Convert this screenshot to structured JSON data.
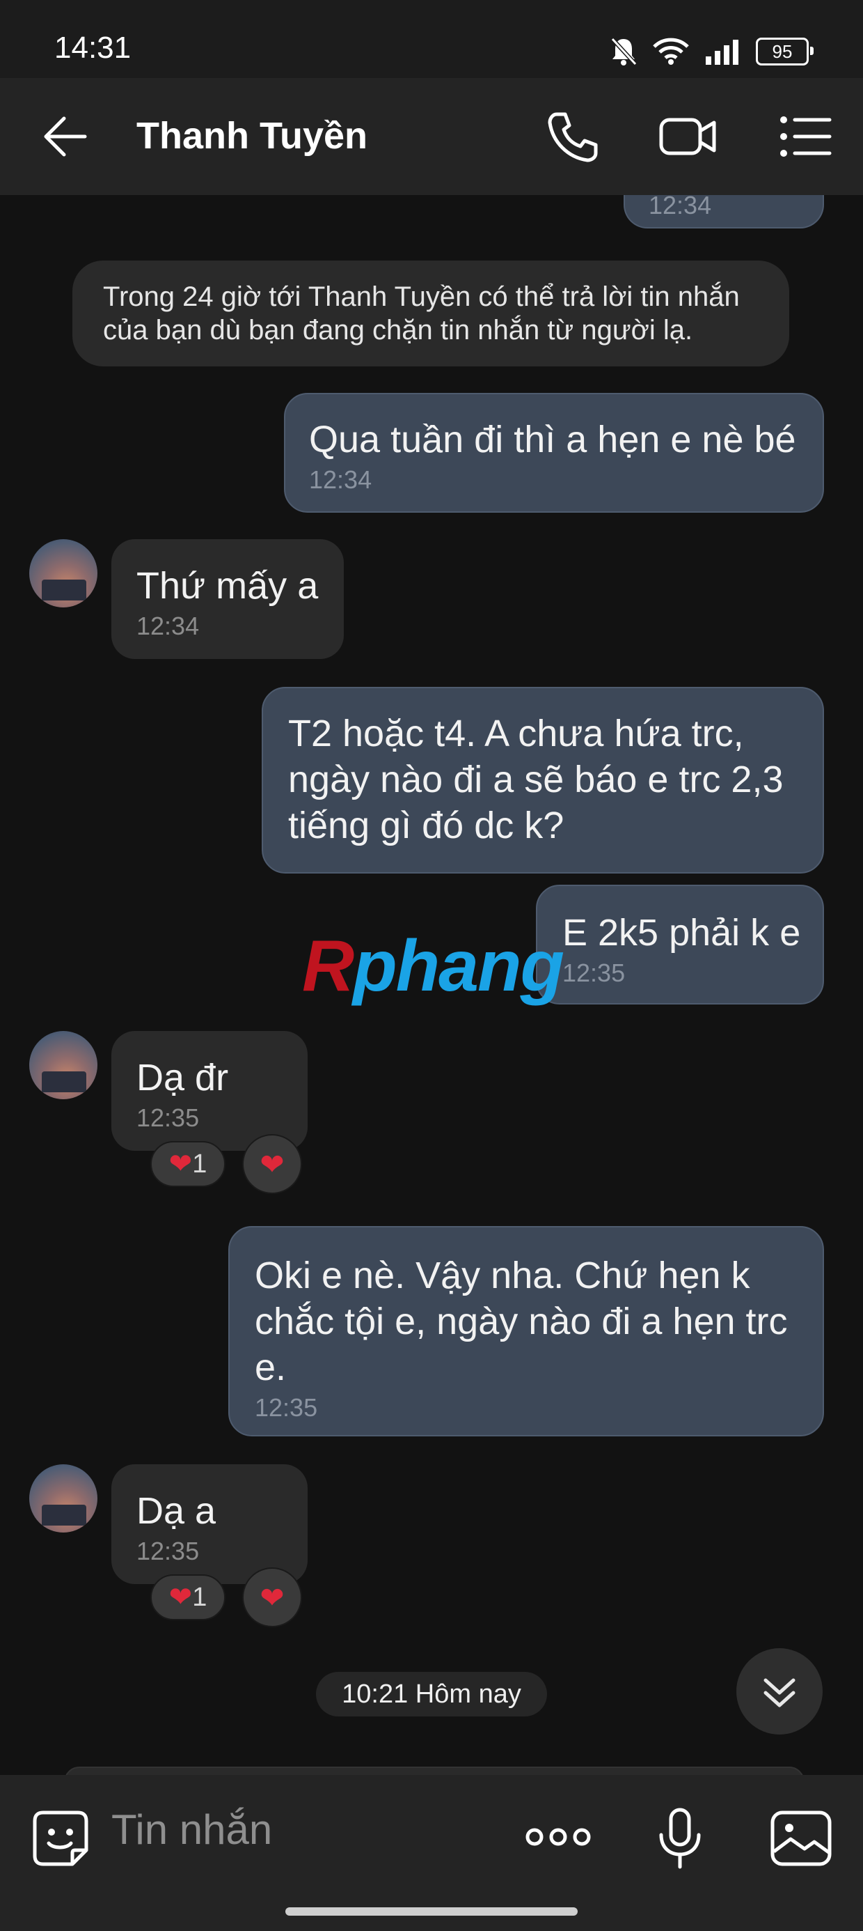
{
  "status_bar": {
    "time": "14:31",
    "battery": "95"
  },
  "header": {
    "contact_name": "Thanh Tuyền"
  },
  "notice_text": "Trong 24 giờ tới Thanh Tuyền có thể trả lời tin nhắn của bạn dù bạn đang chặn tin nhắn từ người lạ.",
  "messages": [
    {
      "direction": "out",
      "time": "12:34"
    },
    {
      "direction": "out",
      "text": "Qua tuần đi thì a hẹn e nè bé",
      "time": "12:34"
    },
    {
      "direction": "in",
      "text": "Thứ mấy a",
      "time": "12:34"
    },
    {
      "direction": "out",
      "text": "T2 hoặc t4. A chưa hứa trc, ngày nào đi a sẽ báo e trc 2,3 tiếng gì đó dc k?"
    },
    {
      "direction": "out",
      "text": "E 2k5 phải k e",
      "time": "12:35"
    },
    {
      "direction": "in",
      "text": "Dạ đr",
      "time": "12:35",
      "reaction_count": "1"
    },
    {
      "direction": "out",
      "text": "Oki e nè. Vậy nha. Chứ hẹn k chắc tội e, ngày nào đi a hẹn trc e.",
      "time": "12:35"
    },
    {
      "direction": "in",
      "text": "Dạ a",
      "time": "12:35",
      "reaction_count": "1"
    }
  ],
  "day_separator": "10:21 Hôm nay",
  "watermark": {
    "first": "R",
    "rest": "phang"
  },
  "input": {
    "placeholder": "Tin nhắn"
  },
  "icons": {
    "back": "arrow-left-icon",
    "call": "phone-icon",
    "video": "video-camera-icon",
    "menu": "list-menu-icon",
    "sticker": "sticker-face-icon",
    "more": "more-dots-icon",
    "mic": "microphone-icon",
    "image": "image-icon",
    "scroll": "chevron-double-down-icon",
    "reaction": "heart-icon"
  },
  "colors": {
    "outgoing_bubble": "#3d4858",
    "incoming_bubble": "#2a2a2a",
    "background": "#121212",
    "heart": "#e0283a"
  }
}
